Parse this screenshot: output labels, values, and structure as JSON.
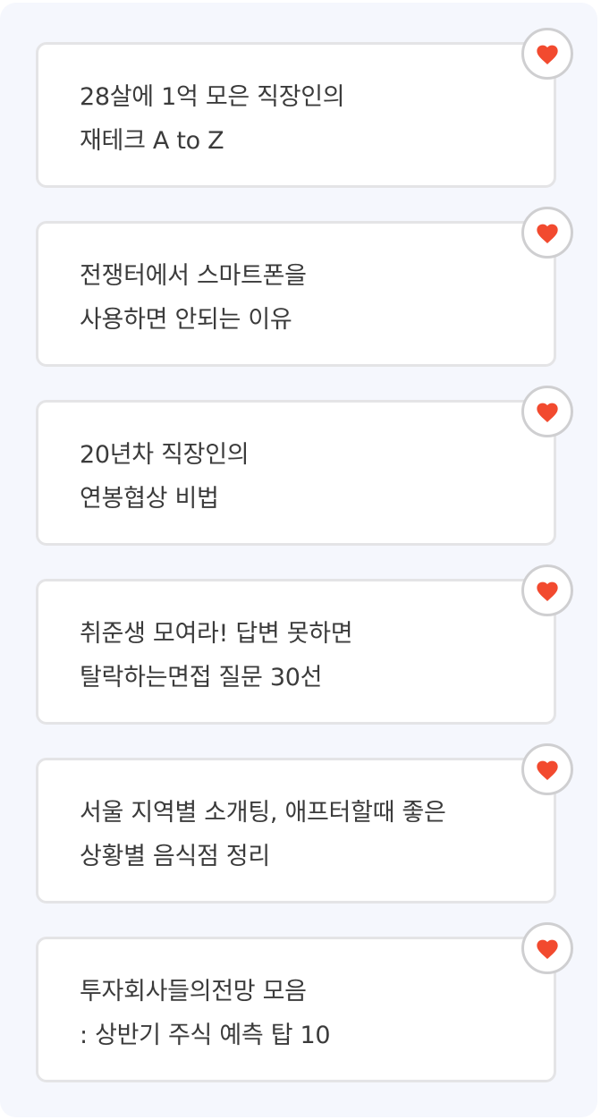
{
  "colors": {
    "background_panel": "#f5f7fd",
    "card_border": "#e4e4e6",
    "text": "#3b3b3b",
    "heart": "#f24a2f",
    "fav_border": "#cfcfd1"
  },
  "cards": [
    {
      "line1": "28살에 1억 모은 직장인의",
      "line2": "재테크 A to Z",
      "icon": "heart-icon",
      "favorited": true
    },
    {
      "line1": "전쟁터에서 스마트폰을",
      "line2": "사용하면 안되는 이유",
      "icon": "heart-icon",
      "favorited": true
    },
    {
      "line1": "20년차 직장인의",
      "line2": "연봉협상 비법",
      "icon": "heart-icon",
      "favorited": true
    },
    {
      "line1": "취준생 모여라! 답변 못하면",
      "line2": "탈락하는면접 질문 30선",
      "icon": "heart-icon",
      "favorited": true
    },
    {
      "line1": "서울 지역별 소개팅, 애프터할때 좋은",
      "line2": "상황별 음식점 정리",
      "icon": "heart-icon",
      "favorited": true
    },
    {
      "line1": "투자회사들의전망 모음",
      "line2": ": 상반기 주식 예측 탑 10",
      "icon": "heart-icon",
      "favorited": true
    }
  ]
}
